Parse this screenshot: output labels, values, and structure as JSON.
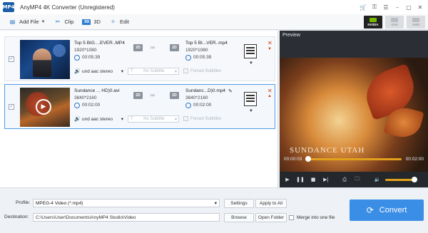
{
  "window": {
    "title": "AnyMP4 4K Converter (Unregistered)",
    "logo_text": "MP4",
    "buttons": [
      "cart-icon",
      "key-icon",
      "menu-icon",
      "minimize-icon",
      "maximize-icon",
      "close-icon"
    ]
  },
  "toolbar": {
    "add_file": "Add File",
    "clip": "Clip",
    "three_d": "3D",
    "edit": "Edit",
    "accelerators": [
      "NVIDIA",
      "intel",
      "AMD"
    ]
  },
  "files": [
    {
      "source_name": "Top 5 BIG....EVER..MP4",
      "source_res": "1920*1080",
      "source_duration": "00:05:39",
      "output_name": "Top 5 BI...VER..mp4",
      "output_res": "1920*1080",
      "output_duration": "00:05:39",
      "audio": "und aac stereo",
      "subtitle": "No Subtitle",
      "forced_subtitles": "Forced Subtitles",
      "badge": "2D"
    },
    {
      "source_name": "Sundance ... HD)0.avi",
      "source_res": "3840*2160",
      "source_duration": "00:02:00",
      "output_name": "Sundanc...D)0.mp4",
      "output_res": "3840*2160",
      "output_duration": "00:02:00",
      "audio": "und aac stereo",
      "subtitle": "No Subtitle",
      "forced_subtitles": "Forced Subtitles",
      "badge": "2D"
    }
  ],
  "preview": {
    "label": "Preview",
    "overlay_text": "SUNDANCE UTAH",
    "current_time": "00:00:03",
    "total_time": "00:02:00",
    "progress": 0.02,
    "volume": 0.85
  },
  "bottom": {
    "profile_label": "Profile:",
    "profile_value": "MPEG-4 Video (*.mp4)",
    "settings": "Settings",
    "apply_all": "Apply to All",
    "destination_label": "Destination:",
    "destination_value": "C:\\Users\\User\\Documents\\AnyMP4 Studio\\Video",
    "browse": "Browse",
    "open_folder": "Open Folder",
    "merge": "Merge into one file",
    "convert": "Convert"
  }
}
